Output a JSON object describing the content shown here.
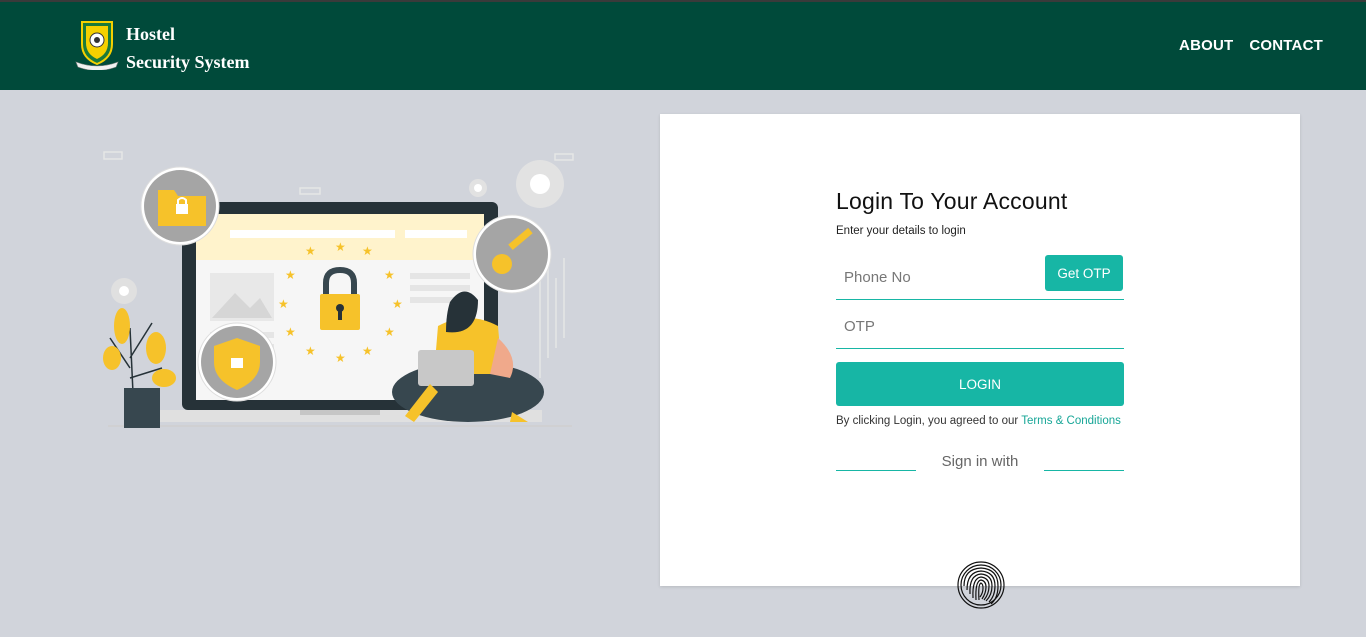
{
  "header": {
    "brand_line1": "Hostel",
    "brand_line2": "Security System",
    "nav": [
      "ABOUT",
      "CONTACT"
    ],
    "background": "#004a3a"
  },
  "login": {
    "title": "Login To Your Account",
    "subtitle": "Enter your details to login",
    "phone_placeholder": "Phone No",
    "get_otp_label": "Get OTP",
    "otp_placeholder": "OTP",
    "login_label": "LOGIN",
    "terms_prefix": "By clicking Login, you agreed to our ",
    "terms_link": "Terms & Conditions",
    "signin_with": "Sign in with",
    "accent": "#17b6a5"
  },
  "icons": {
    "logo": "university-crest-icon",
    "fingerprint": "fingerprint-icon",
    "illustration": "security-laptop-illustration"
  }
}
